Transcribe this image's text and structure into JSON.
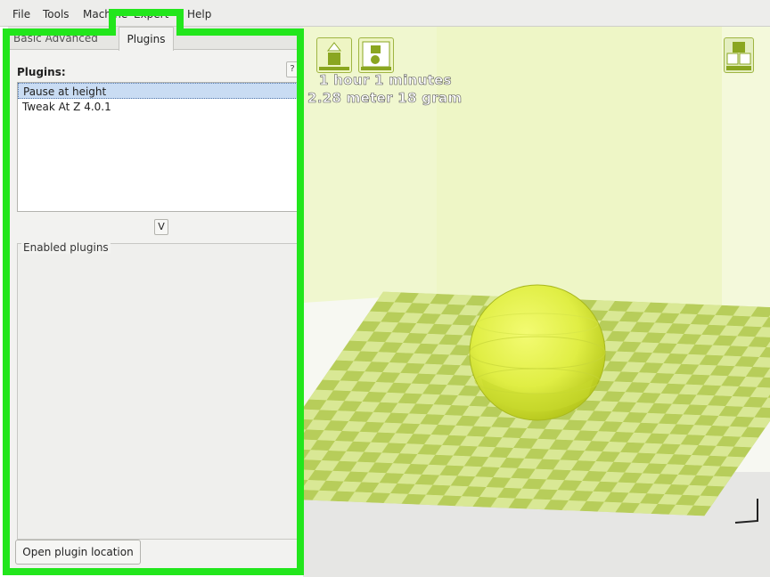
{
  "menubar": {
    "items": [
      "File",
      "Tools",
      "Machine",
      "Expert",
      "Help"
    ]
  },
  "tabs": {
    "basic_label": "Basic",
    "advanced_label": "Advanced",
    "plugins_label": "Plugins"
  },
  "plugins_panel": {
    "header": "Plugins:",
    "help_label": "?",
    "list": [
      "Pause at height",
      "Tweak At Z 4.0.1"
    ],
    "selected": "Pause at height",
    "expand_label": "V",
    "enabled_label": "Enabled plugins",
    "open_location_label": "Open plugin location"
  },
  "viewport": {
    "print_time": "1 hour 1 minutes",
    "print_material": "2.28 meter 18 gram"
  },
  "colors": {
    "highlight": "#22e61c",
    "bed_light": "#d9e895",
    "bed_dark": "#b7cd5a",
    "sphere": "#e2f04a",
    "volume_back": "#eef6c6"
  },
  "icons": [
    "load-model-icon",
    "lay-flat-icon",
    "view-mode-icon"
  ]
}
